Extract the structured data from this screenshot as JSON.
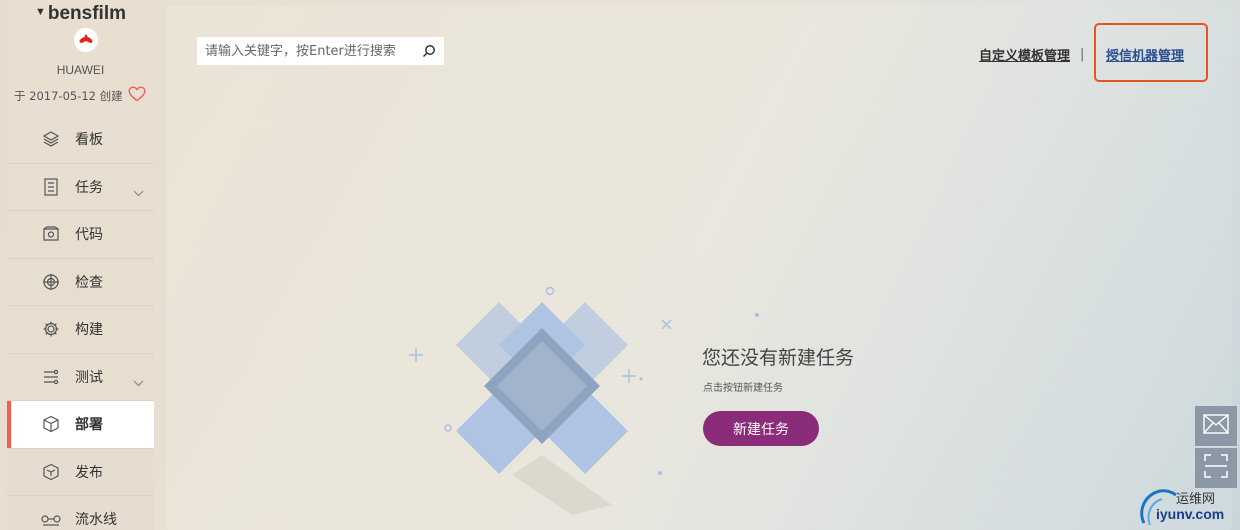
{
  "sidebar": {
    "project_name": "bensfilm",
    "org": "HUAWEI",
    "created": "于 2017-05-12 创建",
    "items": [
      {
        "label": "看板",
        "icon": "layers-icon"
      },
      {
        "label": "任务",
        "icon": "task-list-icon",
        "expandable": true
      },
      {
        "label": "代码",
        "icon": "code-repo-icon"
      },
      {
        "label": "检查",
        "icon": "inspect-icon"
      },
      {
        "label": "构建",
        "icon": "build-gear-icon"
      },
      {
        "label": "测试",
        "icon": "test-icon",
        "expandable": true
      },
      {
        "label": "部署",
        "icon": "deploy-box-icon",
        "active": true
      },
      {
        "label": "发布",
        "icon": "release-icon"
      },
      {
        "label": "流水线",
        "icon": "pipeline-icon"
      }
    ]
  },
  "search": {
    "placeholder": "请输入关键字，按Enter进行搜索"
  },
  "toplinks": {
    "custom_template": "自定义模板管理",
    "separator": "|",
    "trusted_machines": "授信机器管理"
  },
  "empty": {
    "title": "您还没有新建任务",
    "subtitle": "点击按钮新建任务",
    "button": "新建任务"
  },
  "watermark": {
    "line1": "运维网",
    "line2": "iyunv.com"
  },
  "colors": {
    "accent": "#8a2c79",
    "active_bar": "#f25c53",
    "highlight_border": "#e8541f",
    "illus_blue": "#a9c0e3"
  }
}
